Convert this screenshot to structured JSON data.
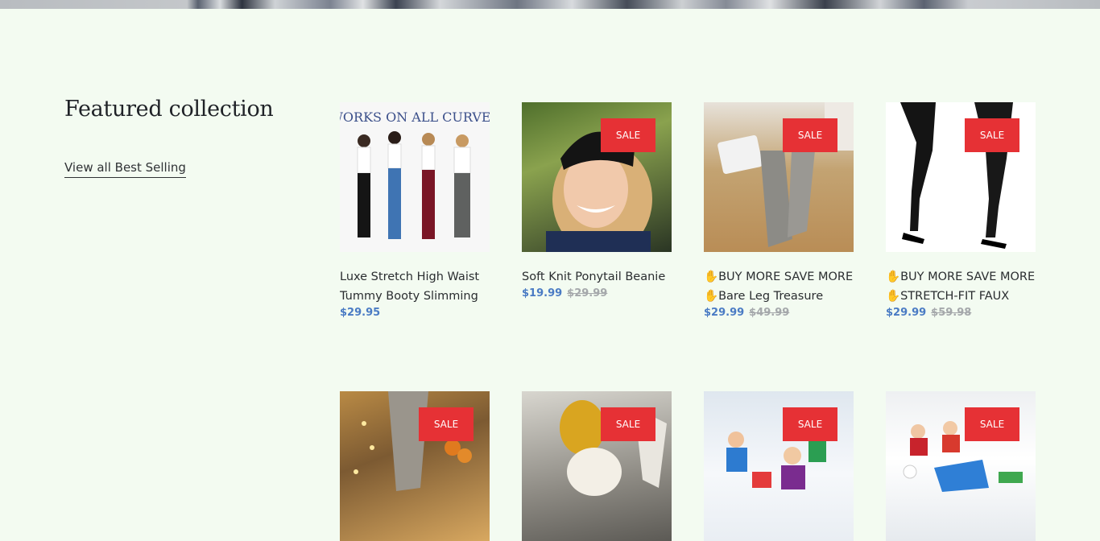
{
  "section": {
    "title": "Featured collection",
    "view_all_label": "View all Best Selling"
  },
  "badge_label": "SALE",
  "products": [
    {
      "title": "Luxe Stretch High Waist Tummy Booty Slimming",
      "price": "$29.95",
      "compare_price": "",
      "on_sale": false,
      "image_text": "WORKS ON ALL CURVES",
      "image_alt": "four women wearing jeans"
    },
    {
      "title": "Soft Knit Ponytail Beanie",
      "price": "$19.99",
      "compare_price": "$29.99",
      "on_sale": true,
      "image_alt": "smiling woman wearing black beanie"
    },
    {
      "title_line1": "BUY MORE SAVE MORE",
      "title_line2": "Bare Leg Treasure",
      "price": "$29.99",
      "compare_price": "$49.99",
      "on_sale": true,
      "image_alt": "legs in grey tights"
    },
    {
      "title_line1": "BUY MORE SAVE MORE",
      "title_line2": "STRETCH-FIT FAUX",
      "price": "$29.99",
      "compare_price": "$59.98",
      "on_sale": true,
      "image_alt": "legs in black faux leather leggings"
    },
    {
      "on_sale": true,
      "image_alt": "grey knit socks with lights"
    },
    {
      "on_sale": true,
      "image_alt": "yellow and white fluffy slippers"
    },
    {
      "on_sale": true,
      "image_alt": "children playing in snow"
    },
    {
      "on_sale": true,
      "image_alt": "kids with snow toys"
    }
  ],
  "colors": {
    "background": "#f3fbf1",
    "sale_badge": "#e63135",
    "price": "#4a7bc4",
    "compare_price": "#a5a8ab"
  }
}
